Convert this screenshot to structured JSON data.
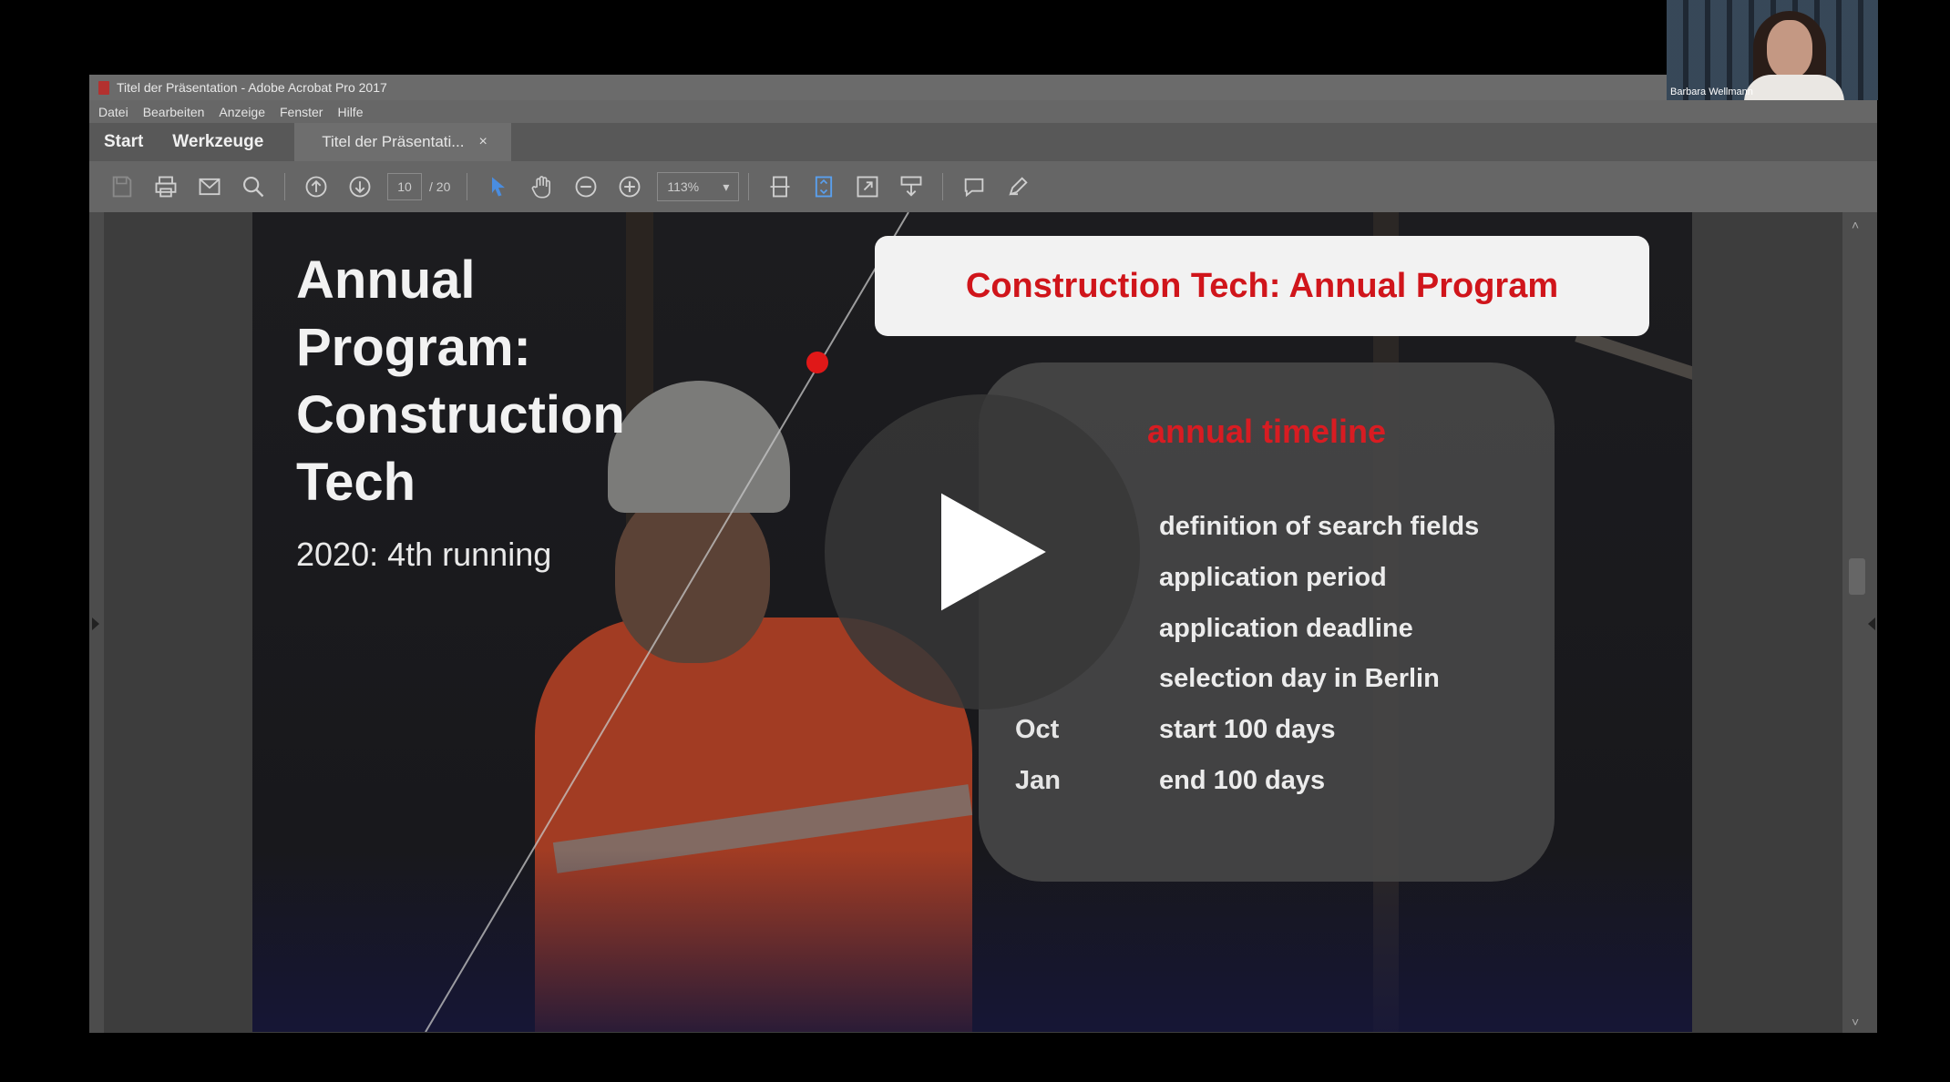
{
  "window": {
    "title": "Titel der Präsentation - Adobe Acrobat Pro 2017"
  },
  "menu": [
    "Datei",
    "Bearbeiten",
    "Anzeige",
    "Fenster",
    "Hilfe"
  ],
  "tabs": {
    "start": "Start",
    "tools": "Werkzeuge",
    "document": "Titel der Präsentati...",
    "close": "×"
  },
  "toolbar": {
    "page_current": "10",
    "page_total": "/ 20",
    "zoom": "113%"
  },
  "slide": {
    "title": "Annual Program: Construction Tech",
    "subtitle": "2020: 4th running",
    "header": "Construction Tech: Annual Program",
    "timeline": {
      "title": "annual timeline",
      "rows": [
        {
          "month": "",
          "text": "definition of search fields"
        },
        {
          "month": "",
          "text": "application period"
        },
        {
          "month": "",
          "text": "application deadline"
        },
        {
          "month": "",
          "text": "selection day in Berlin"
        },
        {
          "month": "Oct",
          "text": "start 100 days"
        },
        {
          "month": "Jan",
          "text": "end 100 days"
        }
      ]
    }
  },
  "webcam": {
    "name": "Barbara Wellmann"
  },
  "colors": {
    "accent_red": "#d0151b",
    "header_box": "#f2f2f2",
    "panel": "#464646"
  }
}
